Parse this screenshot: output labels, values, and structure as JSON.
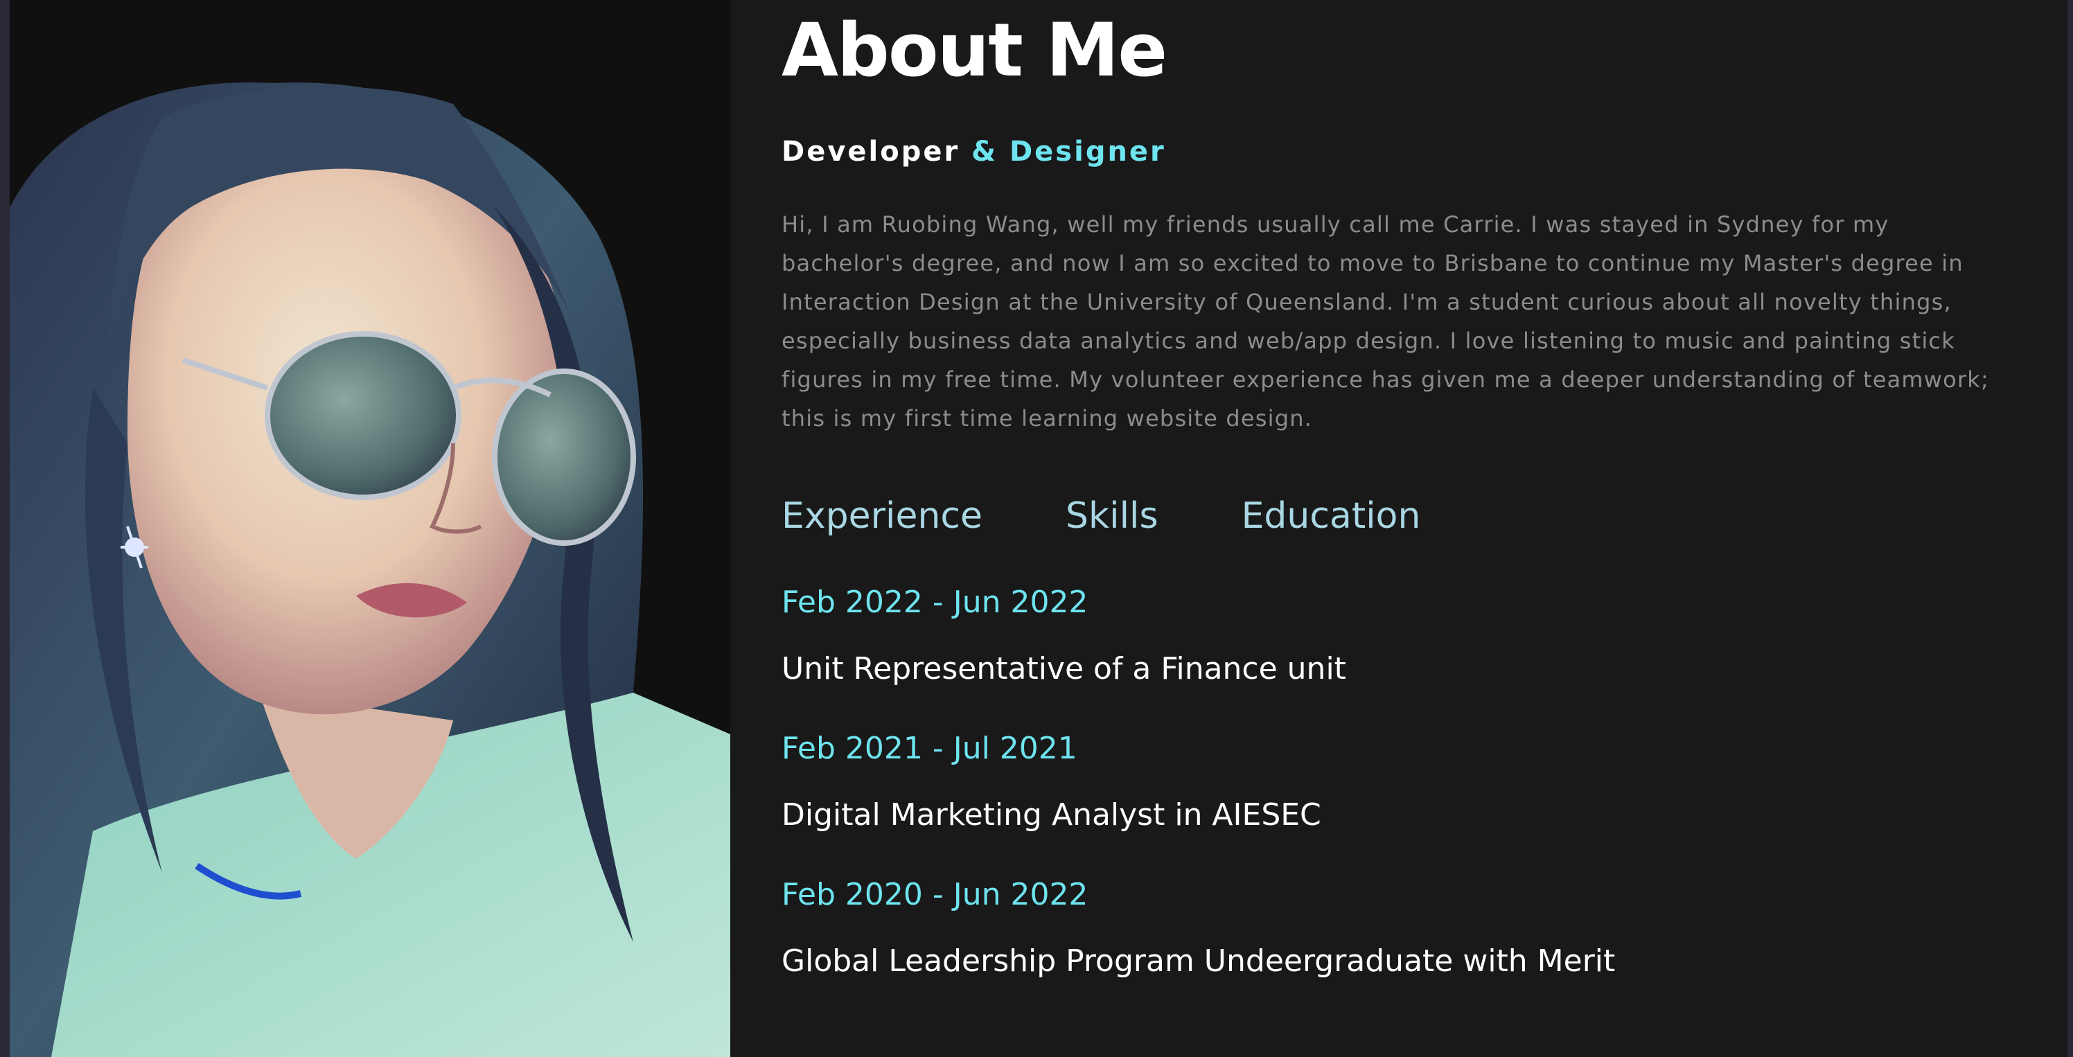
{
  "page": {
    "title": "About Me",
    "subtitle_primary": "Developer",
    "subtitle_accent": "& Designer",
    "intro": "Hi, I am Ruobing Wang, well my friends usually call me Carrie. I was stayed in Sydney for my bachelor's degree, and now I am so excited to move to Brisbane to continue my Master's degree in Interaction Design at the University of Queensland. I'm a student curious about all novelty things, especially business data analytics and web/app design. I love listening to music and painting stick figures in my free time. My volunteer experience has given me a deeper understanding of teamwork; this is my first time learning website design."
  },
  "tabs": [
    {
      "label": "Experience"
    },
    {
      "label": "Skills"
    },
    {
      "label": "Education"
    }
  ],
  "timeline": [
    {
      "date": "Feb 2022 - Jun 2022",
      "role": "Unit Representative of a Finance unit"
    },
    {
      "date": "Feb 2021 - Jul 2021",
      "role": "Digital Marketing Analyst in AIESEC"
    },
    {
      "date": "Feb 2020 - Jun 2022",
      "role": "Global Leadership Program Undeergraduate with Merit"
    }
  ],
  "colors": {
    "background": "#191919",
    "accent": "#6ee4ef",
    "tab": "#a9d7e3",
    "body_text": "#8c8c8c",
    "heading": "#ffffff"
  }
}
